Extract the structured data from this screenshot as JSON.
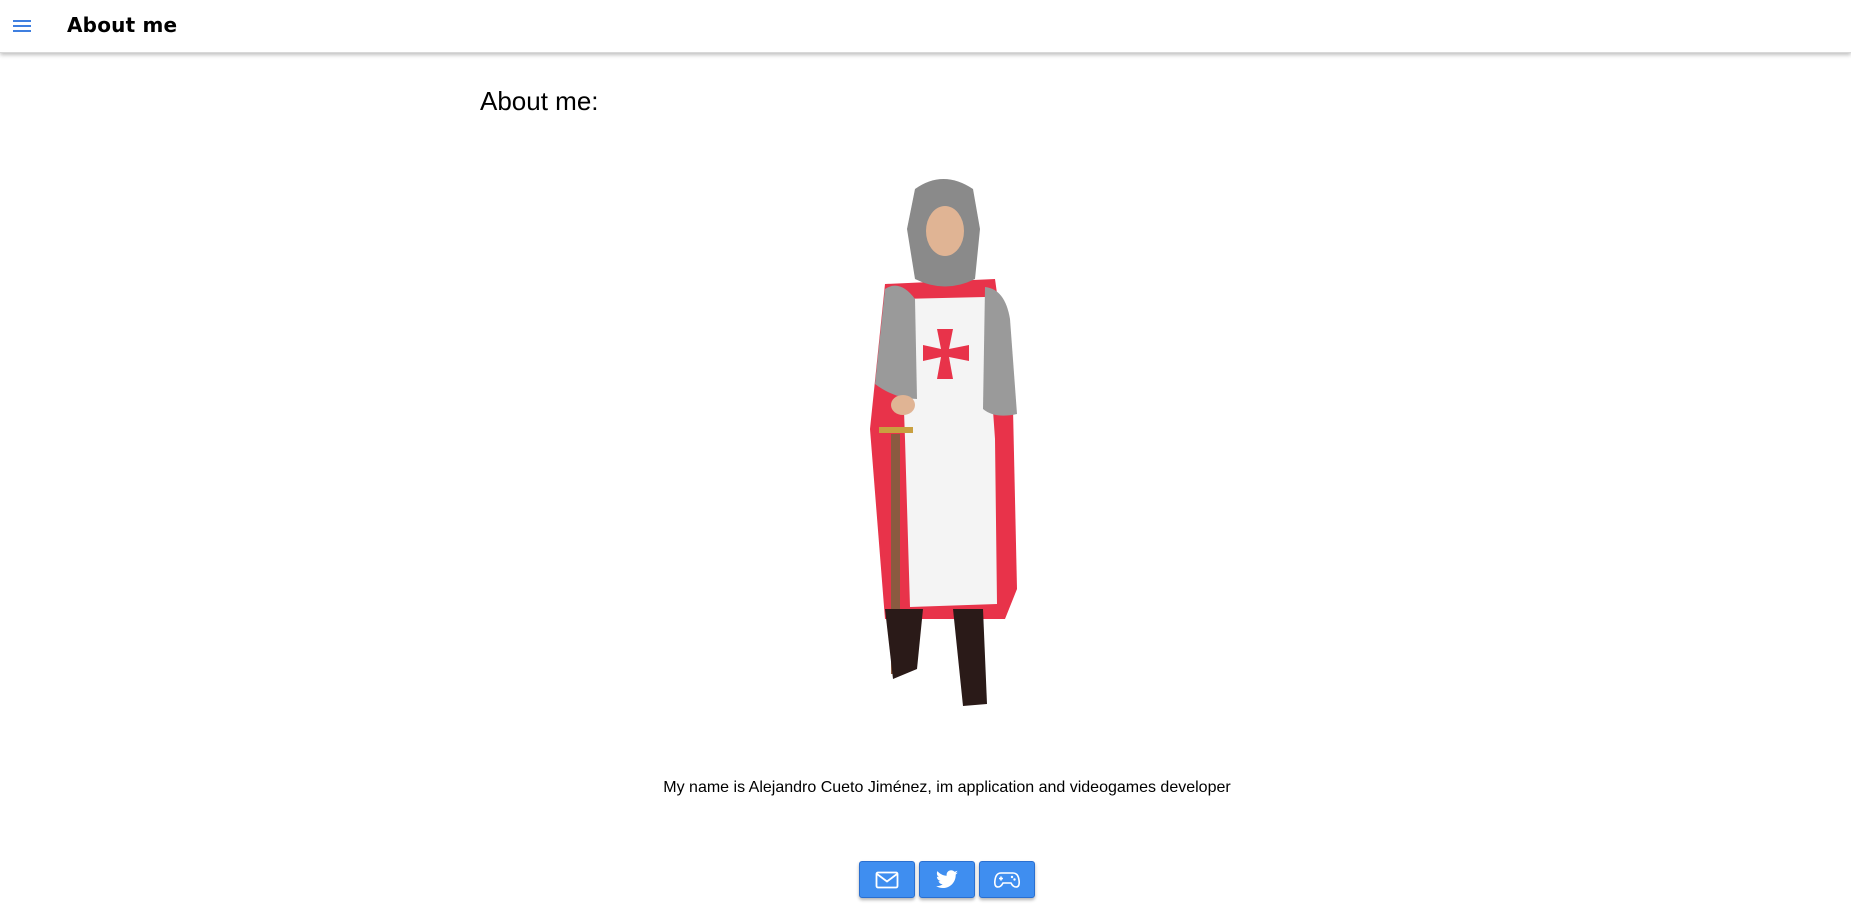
{
  "toolbar": {
    "title": "About me",
    "menu_icon": "hamburger-menu-icon"
  },
  "main": {
    "heading": "About me:",
    "portrait_alt": "knight-costume-portrait",
    "bio": "My name is Alejandro Cueto Jiménez, im application and videogames developer"
  },
  "social": {
    "buttons": [
      {
        "icon": "mail-icon"
      },
      {
        "icon": "twitter-icon"
      },
      {
        "icon": "gamepad-icon"
      }
    ]
  },
  "colors": {
    "accent": "#3f8ef0",
    "menu_icon": "#3f7fe0",
    "cross_red": "#e8334a"
  }
}
